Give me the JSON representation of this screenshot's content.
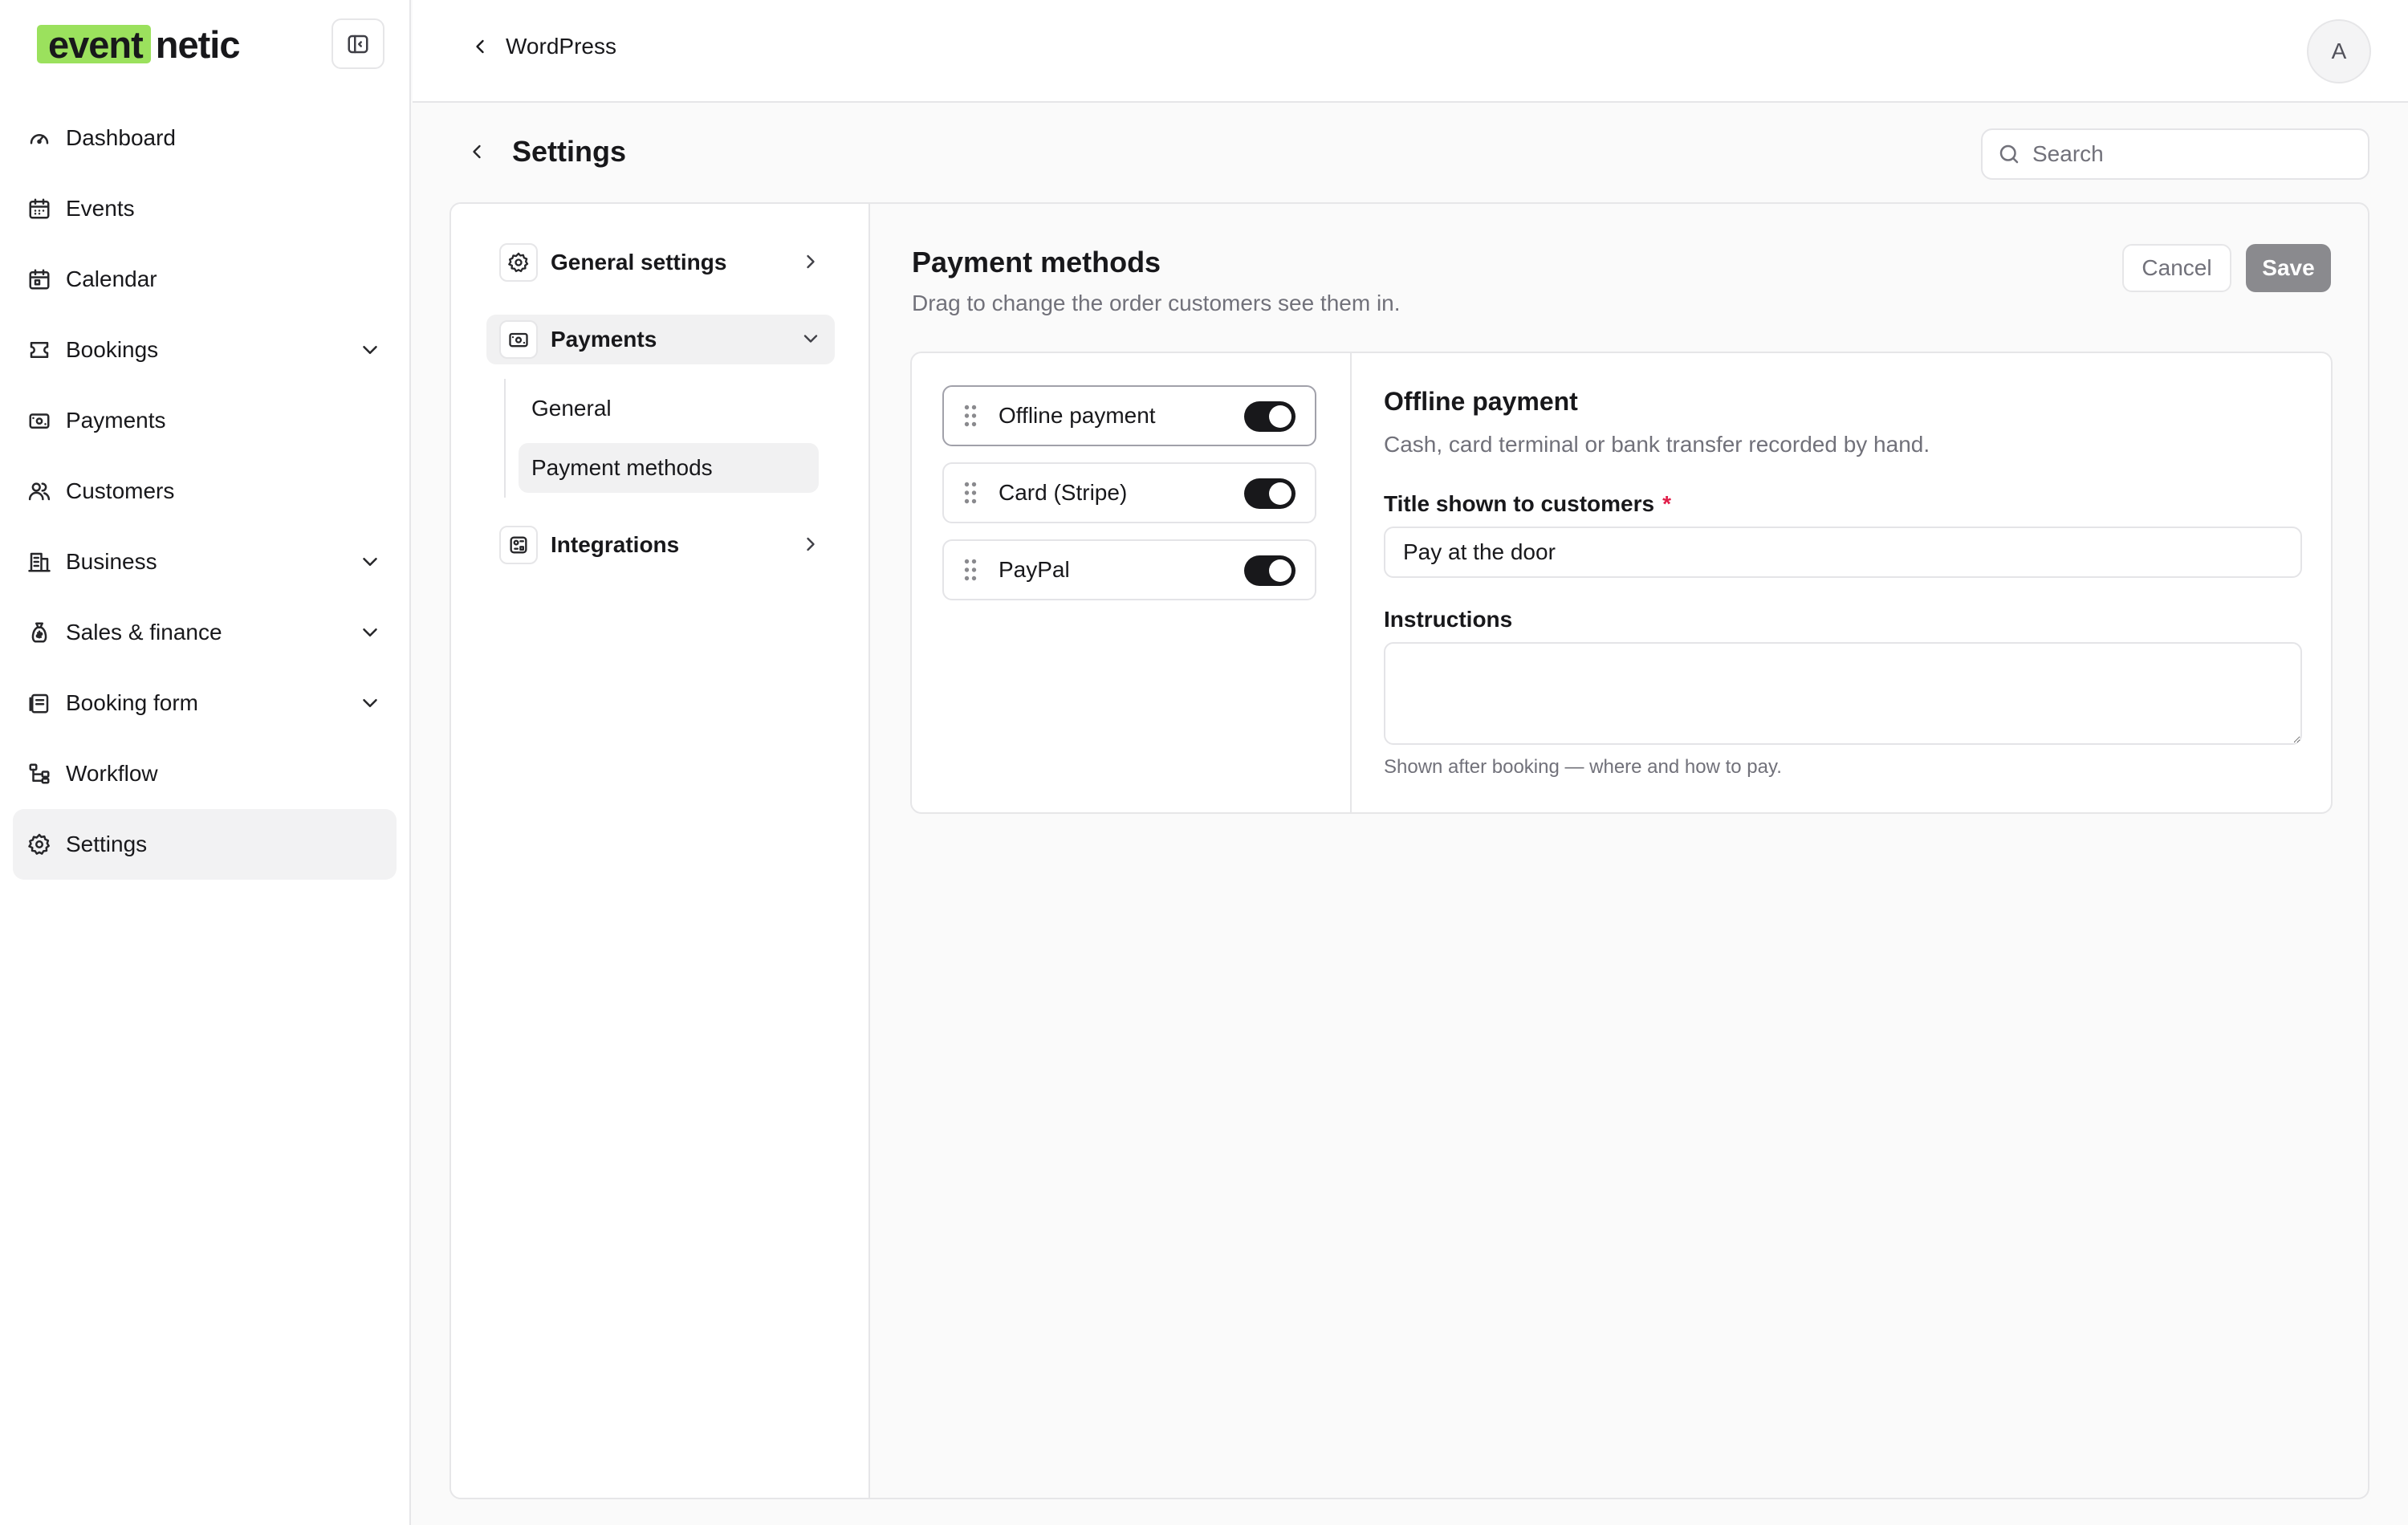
{
  "brand": {
    "logo_part1": "event",
    "logo_part2": "netic",
    "accent_color": "#9be15d"
  },
  "sidebar": {
    "items": [
      {
        "label": "Dashboard",
        "icon": "gauge-icon"
      },
      {
        "label": "Events",
        "icon": "calendar-days-icon"
      },
      {
        "label": "Calendar",
        "icon": "calendar-icon"
      },
      {
        "label": "Bookings",
        "icon": "ticket-icon",
        "expandable": true
      },
      {
        "label": "Payments",
        "icon": "banknote-icon"
      },
      {
        "label": "Customers",
        "icon": "users-icon"
      },
      {
        "label": "Business",
        "icon": "building-icon",
        "expandable": true
      },
      {
        "label": "Sales & finance",
        "icon": "money-bag-icon",
        "expandable": true
      },
      {
        "label": "Booking form",
        "icon": "form-icon",
        "expandable": true
      },
      {
        "label": "Workflow",
        "icon": "workflow-icon"
      },
      {
        "label": "Settings",
        "icon": "gear-icon",
        "active": true
      }
    ]
  },
  "topbar": {
    "back_label": "WordPress",
    "avatar_initial": "A"
  },
  "page": {
    "title": "Settings",
    "search_placeholder": "Search"
  },
  "settings_nav": {
    "general_settings": "General settings",
    "payments": "Payments",
    "payments_sub": [
      "General",
      "Payment methods"
    ],
    "integrations": "Integrations"
  },
  "content": {
    "title": "Payment methods",
    "subtitle": "Drag to change the order customers see them in.",
    "cancel_label": "Cancel",
    "save_label": "Save",
    "methods": [
      {
        "name": "Offline payment",
        "enabled": true,
        "selected": true
      },
      {
        "name": "Card (Stripe)",
        "enabled": true
      },
      {
        "name": "PayPal",
        "enabled": true
      }
    ],
    "detail": {
      "title": "Offline payment",
      "subtitle": "Cash, card terminal or bank transfer recorded by hand.",
      "title_label": "Title shown to customers",
      "required_mark": "*",
      "title_value": "Pay at the door",
      "instructions_label": "Instructions",
      "instructions_value": "",
      "help": "Shown after booking — where and how to pay."
    }
  }
}
